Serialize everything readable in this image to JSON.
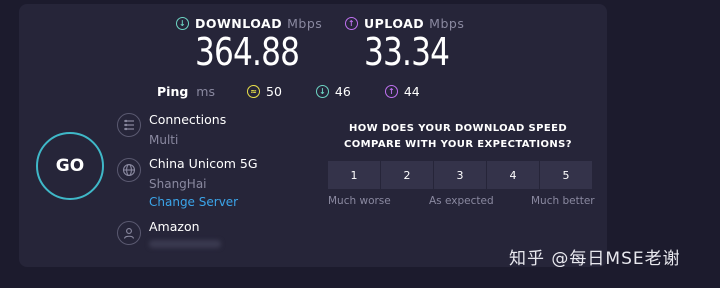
{
  "download": {
    "label": "DOWNLOAD",
    "unit": "Mbps",
    "value": "364.88",
    "icon": "arrow-down-circle-icon"
  },
  "upload": {
    "label": "UPLOAD",
    "unit": "Mbps",
    "value": "33.34",
    "icon": "arrow-up-circle-icon"
  },
  "ping": {
    "label": "Ping",
    "unit": "ms",
    "idle": "50",
    "download": "46",
    "upload": "44"
  },
  "go_button": {
    "label": "GO"
  },
  "connections": {
    "title": "Connections",
    "value": "Multi",
    "icon": "connections-icon"
  },
  "server": {
    "title": "China Unicom 5G",
    "location": "ShangHai",
    "change_link": "Change Server",
    "icon": "globe-icon"
  },
  "provider": {
    "title": "Amazon",
    "icon": "user-icon"
  },
  "survey": {
    "question": "HOW DOES YOUR DOWNLOAD SPEED COMPARE WITH YOUR EXPECTATIONS?",
    "options": [
      "1",
      "2",
      "3",
      "4",
      "5"
    ],
    "low_label": "Much worse",
    "mid_label": "As expected",
    "high_label": "Much better"
  },
  "watermark": {
    "text": "知乎 @每日MSE老谢"
  },
  "colors": {
    "download": "#6dd5c4",
    "upload": "#bf71f0",
    "jitter": "#e9e04a",
    "link": "#3ba5ea",
    "go_ring": "#3fb8c8"
  }
}
